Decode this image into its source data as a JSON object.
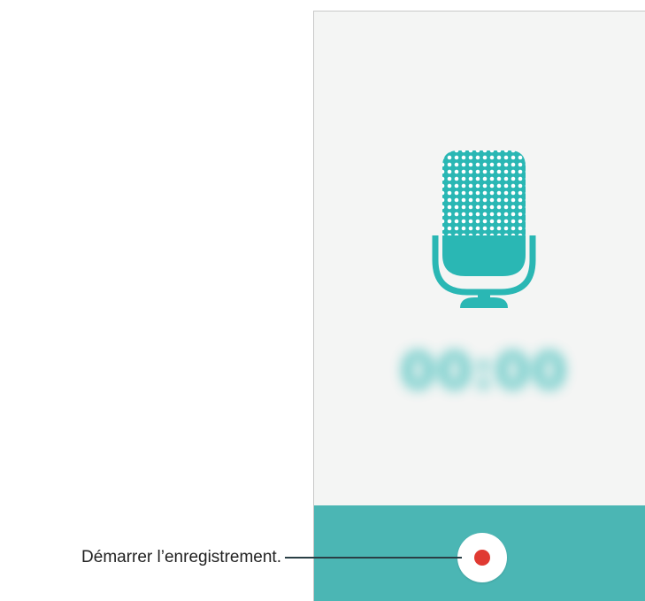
{
  "screen": {
    "mic_icon": "microphone-icon",
    "timer": "00:00"
  },
  "controls": {
    "record_icon": "record-dot-icon"
  },
  "callout": {
    "record_label": "Démarrer l’enregistrement."
  },
  "colors": {
    "accent": "#2ab7b4",
    "bottom_bar": "#4bb6b4",
    "record_dot": "#e03a32",
    "screen_background": "#f4f5f4"
  }
}
